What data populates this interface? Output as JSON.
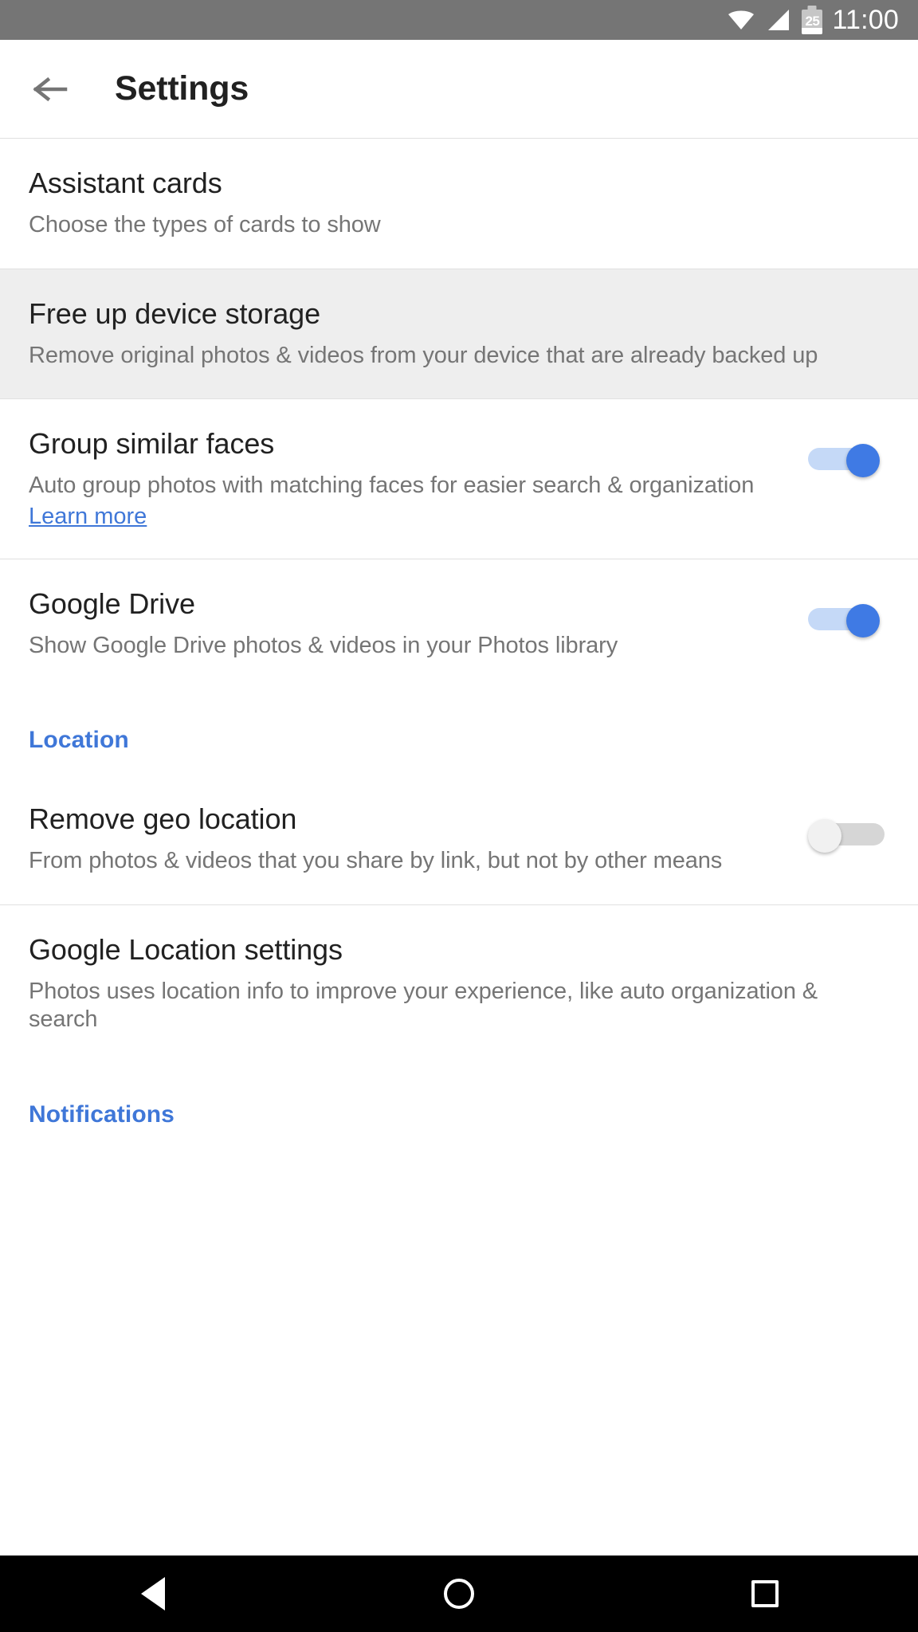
{
  "status_bar": {
    "wifi_icon": "wifi-icon",
    "signal_icon": "cellular-signal-icon",
    "battery_icon": "battery-icon",
    "battery_level": "25",
    "time": "11:00"
  },
  "app_bar": {
    "back_icon": "back-arrow-icon",
    "title": "Settings"
  },
  "colors": {
    "accent_blue": "#3f77d8",
    "toggle_on_thumb": "#3f7ae4",
    "toggle_on_track": "#c5d9f7",
    "toggle_off_thumb": "#f1f1f1",
    "toggle_off_track": "#d6d6d6",
    "status_bar_bg": "#757575",
    "highlight_row_bg": "#eeeeee",
    "title_text": "#212121",
    "desc_text": "#757575"
  },
  "settings": {
    "items": [
      {
        "title": "Assistant cards",
        "desc": "Choose the types of cards to show",
        "has_toggle": false,
        "highlighted": false
      },
      {
        "title": "Free up device storage",
        "desc": "Remove original photos & videos from your device that are already backed up",
        "has_toggle": false,
        "highlighted": true
      },
      {
        "title": "Group similar faces",
        "desc": "Auto group photos with matching faces for easier search & organization",
        "link": "Learn more",
        "has_toggle": true,
        "toggle_state": "on",
        "highlighted": false
      },
      {
        "title": "Google Drive",
        "desc": "Show Google Drive photos & videos in your Photos library",
        "has_toggle": true,
        "toggle_state": "on",
        "highlighted": false
      }
    ],
    "location_section": {
      "header": "Location",
      "items": [
        {
          "title": "Remove geo location",
          "desc": "From photos & videos that you share by link, but not by other means",
          "has_toggle": true,
          "toggle_state": "off"
        },
        {
          "title": "Google Location settings",
          "desc": "Photos uses location info to improve your experience, like auto organization & search",
          "has_toggle": false
        }
      ]
    },
    "notifications_section": {
      "header": "Notifications"
    }
  },
  "nav_bar": {
    "back_label": "back-button",
    "home_label": "home-button",
    "recents_label": "recents-button"
  }
}
